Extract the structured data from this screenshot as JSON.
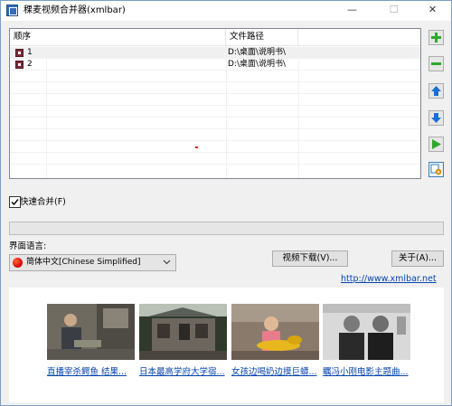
{
  "window": {
    "title": "稞麦视频合并器(xmlbar)",
    "controls": {
      "minimize": "—",
      "maximize": "☐",
      "close": "✕"
    }
  },
  "list": {
    "columns": [
      "顺序",
      "文件路径"
    ],
    "rows": [
      {
        "order": "1",
        "path": "D:\\桌面\\说明书\\"
      },
      {
        "order": "2",
        "path": "D:\\桌面\\说明书\\"
      }
    ]
  },
  "side_buttons": [
    {
      "name": "add-button",
      "icon": "plus-icon",
      "color": "#2ea82e"
    },
    {
      "name": "remove-button",
      "icon": "minus-icon",
      "color": "#2ea82e"
    },
    {
      "name": "move-up-button",
      "icon": "arrow-up-icon",
      "color": "#1a6fd6"
    },
    {
      "name": "move-down-button",
      "icon": "arrow-down-icon",
      "color": "#1a6fd6"
    },
    {
      "name": "start-merge-button",
      "icon": "play-icon",
      "color": "#2ea82e"
    },
    {
      "name": "settings-button",
      "icon": "settings-icon",
      "color": "#e08a00"
    }
  ],
  "options": {
    "fast_merge_label": "快速合并(F)",
    "fast_merge_checked": true
  },
  "progress": {
    "value": 0
  },
  "language": {
    "label": "界面语言:",
    "selected": "简体中文[Chinese Simplified]"
  },
  "buttons": {
    "video_download": "视频下载(V)...",
    "about": "关于(A)..."
  },
  "website_link": "http://www.xmlbar.net",
  "ads": [
    {
      "caption": "直播宰杀鳄鱼 结果..."
    },
    {
      "caption": "日本最高学府大学宿..."
    },
    {
      "caption": "女孩边喝奶边摸巨蟒..."
    },
    {
      "caption": "瞩冯小刚电影主题曲..."
    }
  ],
  "colors": {
    "link": "#0645ad",
    "progress": "#06b025",
    "window_bg": "#f0f0f0"
  }
}
